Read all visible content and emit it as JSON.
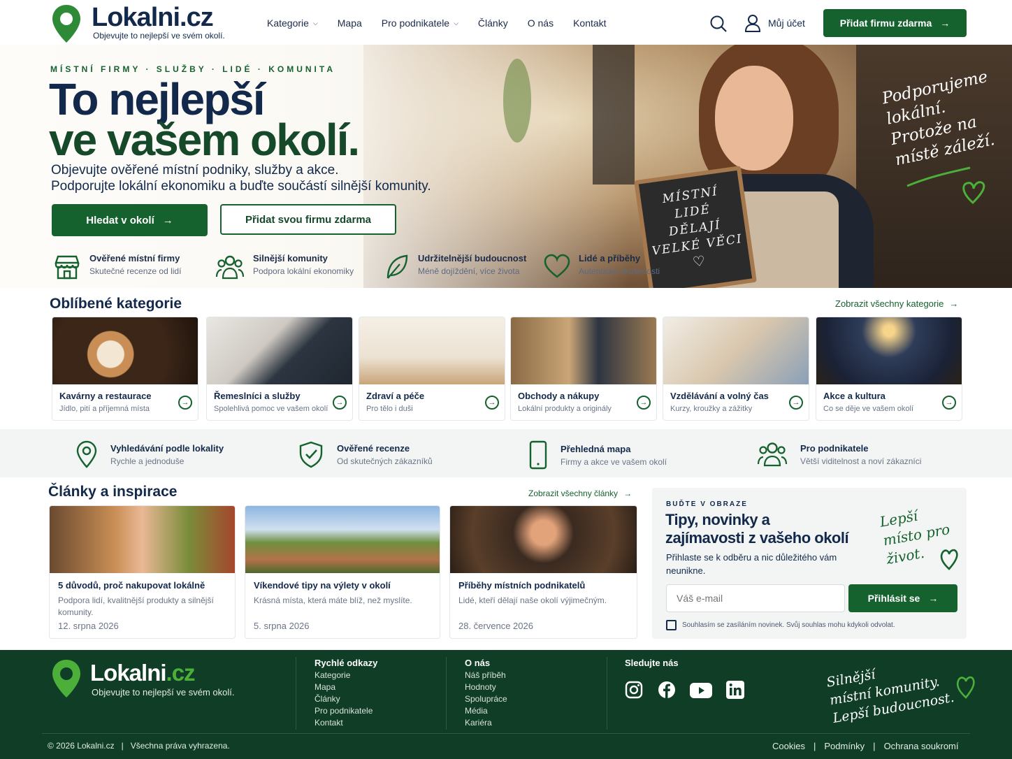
{
  "header": {
    "brand": "Lokalni",
    "brand_tld": ".cz",
    "tagline": "Objevujte to nejlepší ve svém okolí.",
    "nav": [
      {
        "label": "Kategorie",
        "dropdown": true
      },
      {
        "label": "Mapa",
        "dropdown": false
      },
      {
        "label": "Pro podnikatele",
        "dropdown": true
      },
      {
        "label": "Články",
        "dropdown": false
      },
      {
        "label": "O nás",
        "dropdown": false
      },
      {
        "label": "Kontakt",
        "dropdown": false
      }
    ],
    "account_label": "Můj účet",
    "cta_label": "Přidat firmu zdarma"
  },
  "hero": {
    "eyebrow": "MÍSTNÍ FIRMY · SLUŽBY · LIDÉ · KOMUNITA",
    "headline_line1": "To nejlepší",
    "headline_line2": "ve vašem okolí.",
    "subtitle_line1": "Objevujte ověřené místní podniky, služby a akce.",
    "subtitle_line2": "Podporujte lokální ekonomiku a buďte součástí silnější komunity.",
    "primary_button": "Hledat v okolí",
    "secondary_button": "Přidat svou firmu zdarma",
    "chalkboard": [
      "MÍSTNÍ",
      "LIDÉ",
      "DĚLAJÍ",
      "VELKÉ VĚCI"
    ],
    "handwritten": [
      "Podporujeme",
      "lokální.",
      "Protože na",
      "místě záleží."
    ],
    "features": [
      {
        "icon": "store-icon",
        "title": "Ověřené místní firmy",
        "subtitle": "Skutečné recenze od lidí"
      },
      {
        "icon": "people-icon",
        "title": "Silnější komunity",
        "subtitle": "Podpora lokální ekonomiky"
      },
      {
        "icon": "leaf-icon",
        "title": "Udržitelnější budoucnost",
        "subtitle": "Méně dojíždění, více života"
      },
      {
        "icon": "heart-icon",
        "title": "Lidé a příběhy",
        "subtitle": "Autentické zkušenosti"
      }
    ]
  },
  "categories": {
    "title": "Oblíbené kategorie",
    "all_link": "Zobrazit všechny kategorie",
    "items": [
      {
        "title": "Kavárny a restaurace",
        "subtitle": "Jídlo, pití a příjemná místa"
      },
      {
        "title": "Řemeslníci a služby",
        "subtitle": "Spolehlivá pomoc ve vašem okolí"
      },
      {
        "title": "Zdraví a péče",
        "subtitle": "Pro tělo i duši"
      },
      {
        "title": "Obchody a nákupy",
        "subtitle": "Lokální produkty a originály"
      },
      {
        "title": "Vzdělávání a volný čas",
        "subtitle": "Kurzy, kroužky a zážitky"
      },
      {
        "title": "Akce a kultura",
        "subtitle": "Co se děje ve vašem okolí"
      }
    ]
  },
  "band": [
    {
      "icon": "location-pin-icon",
      "title": "Vyhledávání podle lokality",
      "subtitle": "Rychle a jednoduše"
    },
    {
      "icon": "shield-check-icon",
      "title": "Ověřené recenze",
      "subtitle": "Od skutečných zákazníků"
    },
    {
      "icon": "phone-icon",
      "title": "Přehledná mapa",
      "subtitle": "Firmy a akce ve vašem okolí"
    },
    {
      "icon": "group-icon",
      "title": "Pro podnikatele",
      "subtitle": "Větší viditelnost a noví zákazníci"
    }
  ],
  "articles": {
    "title": "Články a inspirace",
    "all_link": "Zobrazit všechny články",
    "items": [
      {
        "title": "5 důvodů, proč nakupovat lokálně",
        "excerpt": "Podpora lidí, kvalitnější produkty a silnější komunity.",
        "date": "12. srpna 2026"
      },
      {
        "title": "Víkendové tipy na výlety v okolí",
        "excerpt": "Krásná místa, která máte blíž, než myslíte.",
        "date": "5. srpna 2026"
      },
      {
        "title": "Příběhy místních podnikatelů",
        "excerpt": "Lidé, kteří dělají naše okolí výjimečným.",
        "date": "28. července 2026"
      }
    ]
  },
  "newsletter": {
    "eyebrow": "BUĎTE V OBRAZE",
    "title_line1": "Tipy, novinky a",
    "title_line2": "zajímavosti z vašeho okolí",
    "text": "Přihlaste se k odběru a nic důležitého vám neunikne.",
    "email_placeholder": "Váš e-mail",
    "button": "Přihlásit se",
    "consent": "Souhlasím se zasíláním novinek. Svůj souhlas mohu kdykoli odvolat.",
    "handwritten": [
      "Lepší",
      "místo pro",
      "život."
    ]
  },
  "footer": {
    "brand": "Lokalni",
    "brand_tld": ".cz",
    "tagline": "Objevujte to nejlepší ve svém okolí.",
    "quick_title": "Rychlé odkazy",
    "quick_links": [
      "Kategorie",
      "Mapa",
      "Články",
      "Pro podnikatele",
      "Kontakt"
    ],
    "about_title": "O nás",
    "about_links": [
      "Náš příběh",
      "Hodnoty",
      "Spolupráce",
      "Média",
      "Kariéra"
    ],
    "social_title": "Sledujte nás",
    "social": [
      "instagram-icon",
      "facebook-icon",
      "youtube-icon",
      "linkedin-icon"
    ],
    "handwritten": [
      "Silnější",
      "místní komunity.",
      "Lepší budoucnost."
    ],
    "copyright": "© 2026 Lokalni.cz",
    "rights": "Všechna práva vyhrazena.",
    "legal": [
      "Cookies",
      "Podmínky",
      "Ochrana soukromí"
    ]
  },
  "colors": {
    "primary": "#16622f",
    "navy": "#13294b",
    "footer": "#0f3d26",
    "accent": "#4caf3a"
  }
}
